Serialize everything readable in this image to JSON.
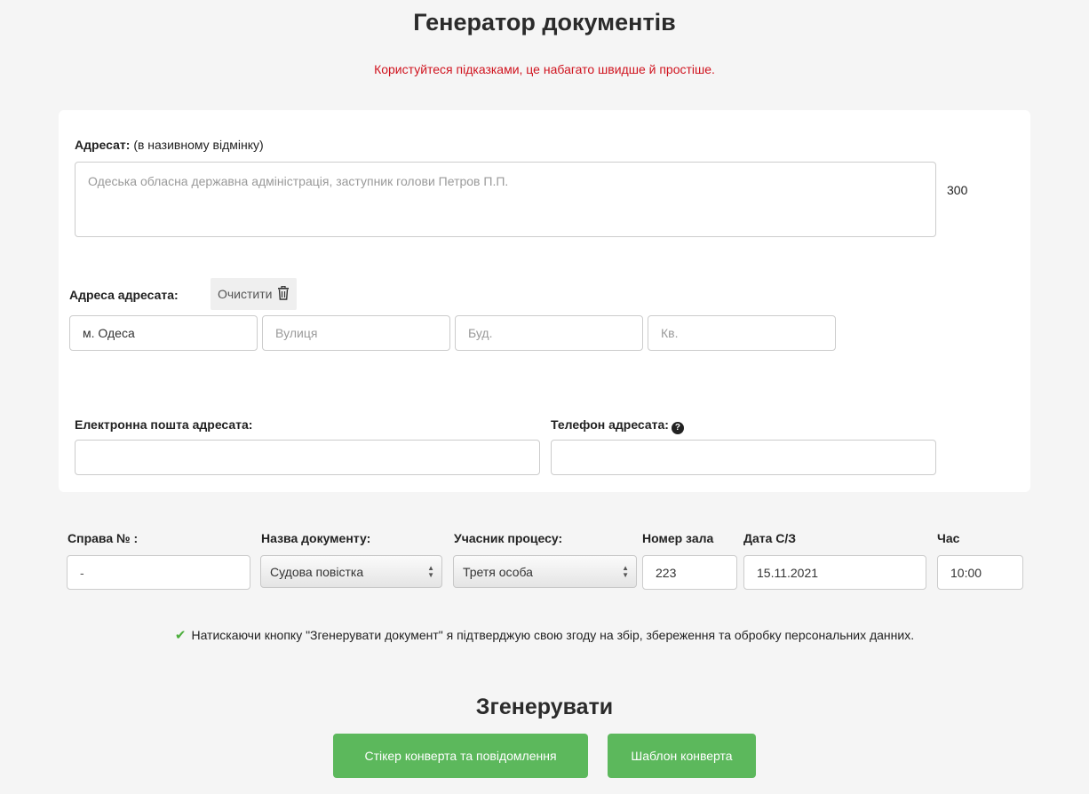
{
  "page": {
    "title": "Генератор документів",
    "hint": "Користуйтеся підказками, це набагато швидше й простіше."
  },
  "addressee": {
    "label": "Адресат:",
    "note": "(в називному відмінку)",
    "placeholder": "Одеська обласна державна адміністрація, заступник голови Петров П.П.",
    "counter": "300"
  },
  "address": {
    "label": "Адреса адресата:",
    "clear_label": "Очистити",
    "city_value": "м. Одеса",
    "street_placeholder": "Вулиця",
    "building_placeholder": "Буд.",
    "apartment_placeholder": "Кв."
  },
  "contacts": {
    "email_label": "Електронна пошта адресата:",
    "phone_label": "Телефон адресата:",
    "email_value": "",
    "phone_value": ""
  },
  "case": {
    "case_number_label": "Справа № :",
    "case_number_value": "-",
    "document_name_label": "Назва документу:",
    "document_name_value": "Судова повістка",
    "participant_label": "Учасник процесу:",
    "participant_value": "Третя особа",
    "hall_label": "Номер зала",
    "hall_value": "223",
    "date_label": "Дата С/З",
    "date_value": "15.11.2021",
    "time_label": "Час",
    "time_value": "10:00"
  },
  "consent": {
    "text": "Натискаючи кнопку \"Згенерувати документ\" я підтверджую свою згоду на збір, збереження та обробку персональних данних."
  },
  "generate": {
    "title": "Згенерувати",
    "sticker_button": "Стікер конверта та повідомлення",
    "template_button": "Шаблон конверта"
  },
  "colors": {
    "hint": "#d0131e",
    "button": "#5cb85c",
    "check": "#4cae3c",
    "background": "#f5f5f5"
  }
}
